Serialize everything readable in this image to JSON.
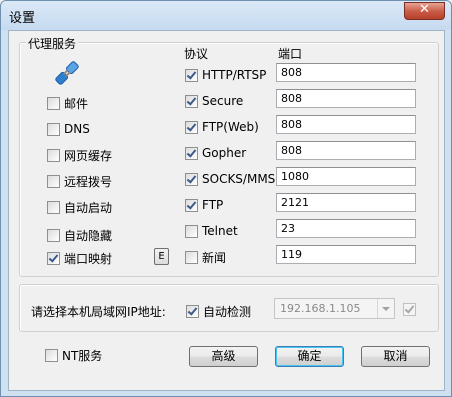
{
  "window": {
    "title": "设置",
    "close_label": "✕"
  },
  "proxy_group": {
    "title": "代理服务",
    "left_options": [
      {
        "label": "邮件",
        "checked": false
      },
      {
        "label": "DNS",
        "checked": false
      },
      {
        "label": "网页缓存",
        "checked": false
      },
      {
        "label": "远程拨号",
        "checked": false
      },
      {
        "label": "自动启动",
        "checked": false
      },
      {
        "label": "自动隐藏",
        "checked": false
      },
      {
        "label": "端口映射",
        "checked": true
      }
    ],
    "e_button_label": "E",
    "protocol_header": "协议",
    "port_header": "端口",
    "protocols": [
      {
        "label": "HTTP/RTSP",
        "checked": true,
        "port": "808"
      },
      {
        "label": "Secure",
        "checked": true,
        "port": "808"
      },
      {
        "label": "FTP(Web)",
        "checked": true,
        "port": "808"
      },
      {
        "label": "Gopher",
        "checked": true,
        "port": "808"
      },
      {
        "label": "SOCKS/MMS",
        "checked": true,
        "port": "1080"
      },
      {
        "label": "FTP",
        "checked": true,
        "port": "2121"
      },
      {
        "label": "Telnet",
        "checked": false,
        "port": "23"
      },
      {
        "label": "新闻",
        "checked": false,
        "port": "119"
      }
    ]
  },
  "ip_group": {
    "label": "请选择本机局域网IP地址:",
    "auto_detect_label": "自动检测",
    "auto_detect_checked": true,
    "ip_value": "192.168.1.105",
    "extra_checked": true
  },
  "footer": {
    "nt_service_label": "NT服务",
    "nt_service_checked": false,
    "advanced_label": "高级",
    "ok_label": "确定",
    "cancel_label": "取消"
  }
}
